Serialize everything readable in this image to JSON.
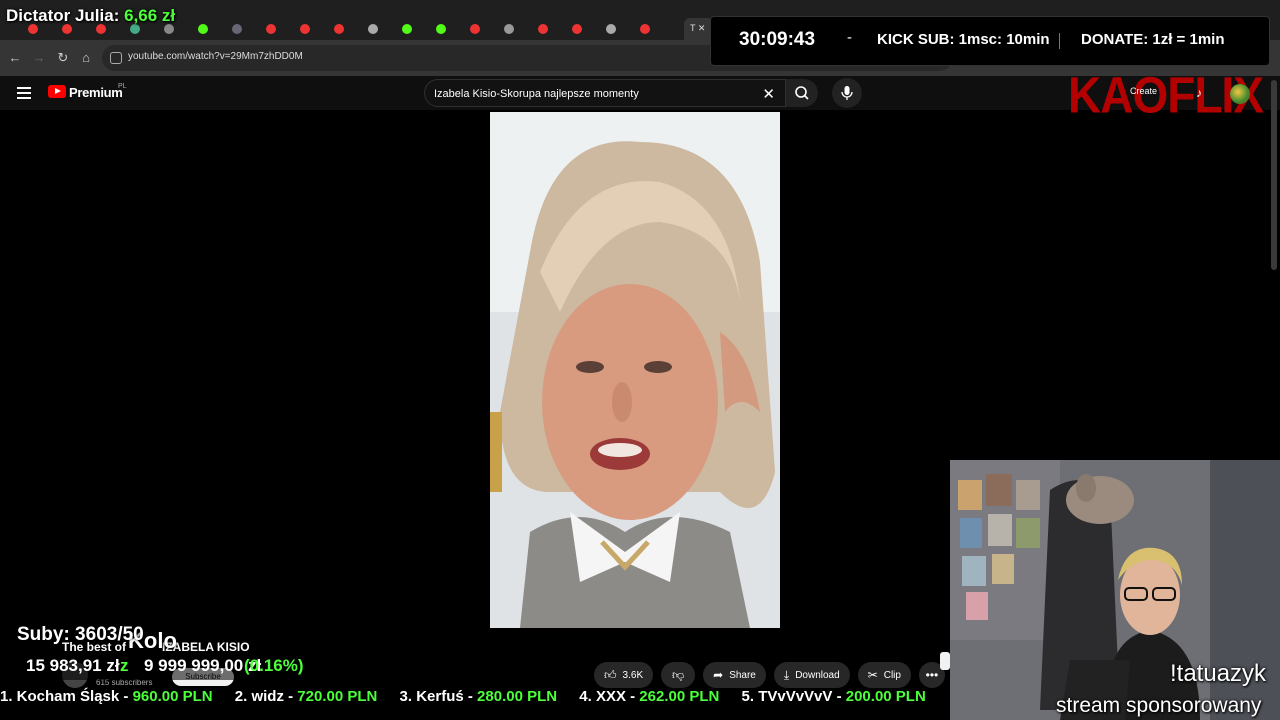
{
  "overlay": {
    "dictator_label": "Dictator Julia:",
    "dictator_amount": "6,66 zł",
    "timer": "30:09:43",
    "timer_sign": "-",
    "kick_sub": "KICK SUB: 1msc: 10min",
    "donate": "DONATE: 1zł = 1min",
    "subs": "Suby: 3603/50",
    "goal_current": "15 983,91 zł",
    "goal_z": "z",
    "goal_target": "9 999 999,00 zł",
    "goal_pct": "(0.16%)",
    "command": "!tatuazyk",
    "sponsor": "stream sponsorowany",
    "brand": "KAOFLIX"
  },
  "browser": {
    "url": "youtube.com/watch?v=29Mm7zhDD0M",
    "active_tab": "T"
  },
  "youtube": {
    "premium": "Premium",
    "region": "PL",
    "search_value": "Izabela Kisio-Skorupa najlepsze momenty",
    "create": "Create",
    "channel_best": "The best of",
    "channel_kisio": "IZABELA KISIO",
    "channel_kolo": "Kolo",
    "subscribers": "615 subscribers",
    "subscribe": "Subscribe",
    "likes": "3.6K",
    "share": "Share",
    "download": "Download",
    "clip": "Clip"
  },
  "ticker": [
    {
      "name": "1. Kocham Śląsk -",
      "amount": "960.00 PLN"
    },
    {
      "name": "2. widz -",
      "amount": "720.00 PLN"
    },
    {
      "name": "3. Kerfuś -",
      "amount": "280.00 PLN"
    },
    {
      "name": "4. XXX -",
      "amount": "262.00 PLN"
    },
    {
      "name": "5. TVvVvVvV -",
      "amount": "200.00 PLN"
    }
  ],
  "colors": {
    "accent_green": "#4cff3a",
    "youtube_red": "#ff0000",
    "brand_red": "#b30000"
  }
}
